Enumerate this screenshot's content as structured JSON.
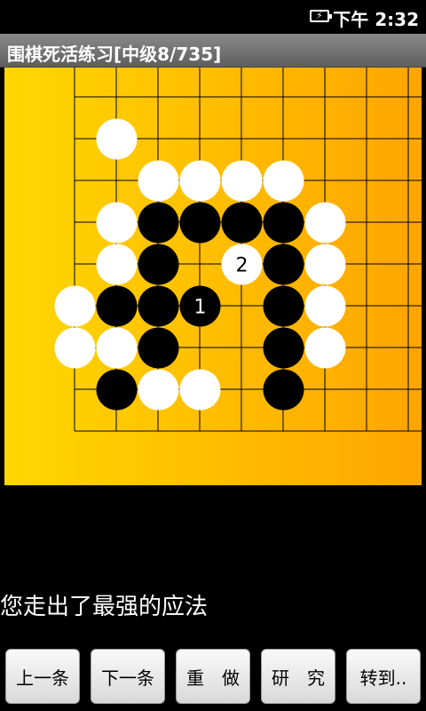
{
  "status_bar": {
    "time": "下午 2:32",
    "battery_icon": "battery-charging-icon"
  },
  "title_bar": {
    "title": "围棋死活练习[中级8/735]"
  },
  "board": {
    "grid_visible": "top-right portion of 19x19 board",
    "background_colors": [
      "#ffd700",
      "#ffa500"
    ],
    "stones": [
      {
        "color": "white",
        "col": 1,
        "row": 1
      },
      {
        "color": "white",
        "col": 2,
        "row": 2
      },
      {
        "color": "white",
        "col": 3,
        "row": 2
      },
      {
        "color": "white",
        "col": 4,
        "row": 2
      },
      {
        "color": "white",
        "col": 5,
        "row": 2
      },
      {
        "color": "white",
        "col": 1,
        "row": 3
      },
      {
        "color": "black",
        "col": 2,
        "row": 3
      },
      {
        "color": "black",
        "col": 3,
        "row": 3
      },
      {
        "color": "black",
        "col": 4,
        "row": 3
      },
      {
        "color": "black",
        "col": 5,
        "row": 3
      },
      {
        "color": "white",
        "col": 6,
        "row": 3
      },
      {
        "color": "white",
        "col": 1,
        "row": 4
      },
      {
        "color": "black",
        "col": 2,
        "row": 4
      },
      {
        "color": "white",
        "col": 4,
        "row": 4,
        "label": "2"
      },
      {
        "color": "black",
        "col": 5,
        "row": 4
      },
      {
        "color": "white",
        "col": 6,
        "row": 4
      },
      {
        "color": "white",
        "col": 0,
        "row": 5
      },
      {
        "color": "black",
        "col": 1,
        "row": 5
      },
      {
        "color": "black",
        "col": 2,
        "row": 5
      },
      {
        "color": "black",
        "col": 3,
        "row": 5,
        "label": "1"
      },
      {
        "color": "black",
        "col": 5,
        "row": 5
      },
      {
        "color": "white",
        "col": 6,
        "row": 5
      },
      {
        "color": "white",
        "col": 0,
        "row": 6
      },
      {
        "color": "white",
        "col": 1,
        "row": 6
      },
      {
        "color": "black",
        "col": 2,
        "row": 6
      },
      {
        "color": "black",
        "col": 5,
        "row": 6
      },
      {
        "color": "white",
        "col": 6,
        "row": 6
      },
      {
        "color": "black",
        "col": 1,
        "row": 7
      },
      {
        "color": "white",
        "col": 2,
        "row": 7
      },
      {
        "color": "white",
        "col": 3,
        "row": 7
      },
      {
        "color": "black",
        "col": 5,
        "row": 7
      }
    ]
  },
  "message": "您走出了最强的应法",
  "buttons": [
    {
      "name": "prev-button",
      "label": "上一条"
    },
    {
      "name": "next-button",
      "label": "下一条"
    },
    {
      "name": "redo-button",
      "label": "重　做"
    },
    {
      "name": "study-button",
      "label": "研　究"
    },
    {
      "name": "goto-button",
      "label": "转到.."
    }
  ]
}
